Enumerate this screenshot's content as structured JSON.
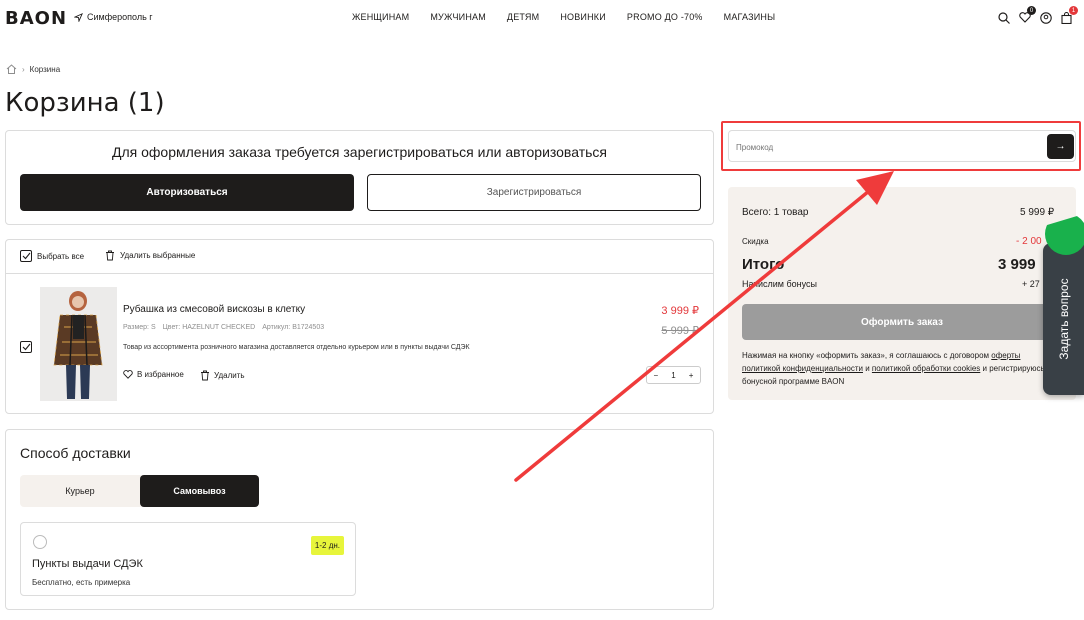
{
  "header": {
    "logo": "BAON",
    "city": "Симферополь г",
    "nav": [
      "ЖЕНЩИНАМ",
      "МУЖЧИНАМ",
      "ДЕТЯМ",
      "НОВИНКИ",
      "PROMO ДО -70%",
      "МАГАЗИНЫ"
    ],
    "favorites_count": "0",
    "cart_count": "1",
    "icons": [
      "search-icon",
      "heart-icon",
      "user-icon",
      "bag-icon"
    ]
  },
  "breadcrumb": {
    "current": "Корзина"
  },
  "page_title": "Корзина (1)",
  "auth": {
    "text": "Для оформления заказа требуется зарегистрироваться или авторизоваться",
    "login_label": "Авторизоваться",
    "register_label": "Зарегистрироваться"
  },
  "cart": {
    "select_all": "Выбрать все",
    "delete_selected": "Удалить выбранные",
    "item": {
      "name": "Рубашка из смесовой вискозы в клетку",
      "size_label": "Размер: S",
      "color_label": "Цвет: HAZELNUT CHECKED",
      "article_label": "Артикул: B1724503",
      "price": "3 999 ₽",
      "old_price": "5 999 ₽",
      "note": "Товар из ассортимента розничного магазина доставляется отдельно курьером или в пункты выдачи СДЭК",
      "favorite_label": "В избранное",
      "delete_label": "Удалить",
      "qty_minus": "−",
      "quantity": "1",
      "qty_plus": "+"
    }
  },
  "delivery": {
    "title": "Способ доставки",
    "tabs": [
      "Курьер",
      "Самовывоз"
    ],
    "active_tab": "Самовывоз",
    "option": {
      "name": "Пункты выдачи СДЭК",
      "sub": "Бесплатно, есть примерка",
      "badge": "1-2 дн."
    }
  },
  "promo": {
    "placeholder": "Промокод",
    "apply_icon": "→"
  },
  "summary": {
    "total_label": "Всего: 1 товар",
    "total_value": "5 999 ₽",
    "discount_label": "Скидка",
    "discount_value": "- 2 00",
    "itogo_label": "Итого",
    "itogo_value": "3 999",
    "bonus_label": "Начислим бонусы",
    "bonus_value": "+ 27",
    "checkout_label": "Оформить заказ",
    "legal_before": "Нажимая на кнопку «оформить заказ», я соглашаюсь с договором",
    "legal_link1": "оферты",
    "legal_link2": "политикой конфиденциальности",
    "legal_and": "и",
    "legal_link3": "политикой обработки cookies",
    "legal_after": "и регистрируюсь в бонусной программе BAON"
  },
  "help_tab": {
    "label": "Задать вопрос"
  },
  "colors": {
    "accent": "#1e1c1b",
    "price_red": "#e3373a",
    "annotation_red": "#ef3b3b",
    "beige": "#f5f1ed",
    "badge_yellow": "#e7f53b"
  }
}
